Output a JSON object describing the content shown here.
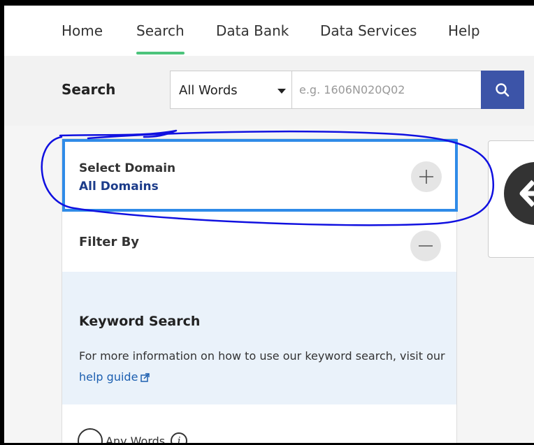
{
  "nav": {
    "items": [
      {
        "label": "Home"
      },
      {
        "label": "Search"
      },
      {
        "label": "Data Bank"
      },
      {
        "label": "Data Services"
      },
      {
        "label": "Help"
      }
    ],
    "active_index": 1
  },
  "search": {
    "label": "Search",
    "mode": "All Words",
    "placeholder": "e.g. 1606N020Q02",
    "button_icon": "search-icon"
  },
  "domain": {
    "title": "Select Domain",
    "value": "All Domains",
    "toggle_icon": "plus-icon"
  },
  "filter": {
    "title": "Filter By",
    "toggle_icon": "minus-icon"
  },
  "keyword": {
    "title": "Keyword Search",
    "description": "For more information on how to use our keyword search, visit our",
    "link_text": "help guide",
    "link_icon": "external-link-icon"
  },
  "options": {
    "any_words": "Any Words",
    "info_icon": "info-icon",
    "info_glyph": "i"
  },
  "colors": {
    "accent": "#3c54a8",
    "active_tab": "#4cc47c",
    "highlight_border": "#2f8be8",
    "annotation": "#1010e0"
  }
}
